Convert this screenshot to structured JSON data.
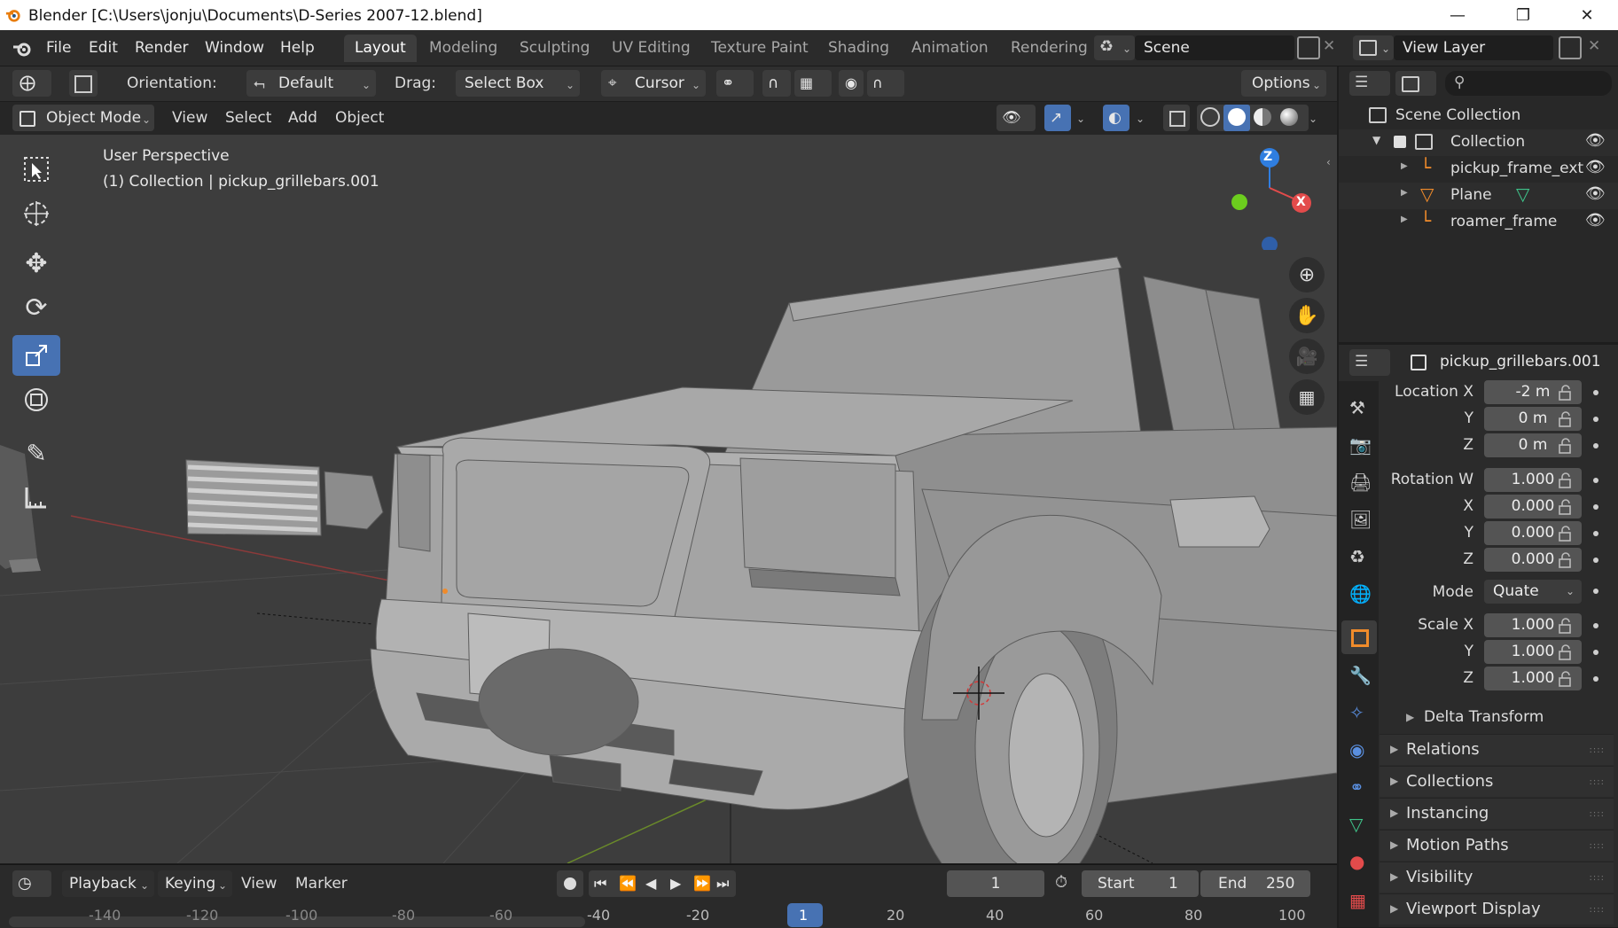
{
  "window": {
    "title": "Blender [C:\\Users\\jonju\\Documents\\D-Series 2007-12.blend]"
  },
  "menu": [
    "File",
    "Edit",
    "Render",
    "Window",
    "Help"
  ],
  "workspaces": [
    "Layout",
    "Modeling",
    "Sculpting",
    "UV Editing",
    "Texture Paint",
    "Shading",
    "Animation",
    "Rendering"
  ],
  "scene": {
    "name": "Scene",
    "view_layer": "View Layer"
  },
  "tool_header": {
    "orientation_label": "Orientation:",
    "orientation_value": "Default",
    "drag_label": "Drag:",
    "drag_value": "Select Box",
    "pivot_value": "Cursor",
    "options": "Options"
  },
  "viewport_header": {
    "mode": "Object Mode",
    "menus": [
      "View",
      "Select",
      "Add",
      "Object"
    ]
  },
  "viewport": {
    "perspective": "User Perspective",
    "collection_info": "(1) Collection | pickup_grillebars.001",
    "gizmo": {
      "x": "X",
      "z": "Z"
    }
  },
  "outliner": {
    "root": "Scene Collection",
    "collection": "Collection",
    "items": [
      {
        "name": "pickup_frame_ext",
        "type": "armature"
      },
      {
        "name": "Plane",
        "type": "mesh"
      },
      {
        "name": "roamer_frame",
        "type": "armature"
      }
    ]
  },
  "properties": {
    "object_name": "pickup_grillebars.001",
    "location": {
      "label": "Location X",
      "x": "-2 m",
      "y": "0 m",
      "z": "0 m"
    },
    "rotation": {
      "label": "Rotation W",
      "w": "1.000",
      "x": "0.000",
      "y": "0.000",
      "z": "0.000"
    },
    "mode_label": "Mode",
    "mode_value": "Quate",
    "scale": {
      "label": "Scale X",
      "x": "1.000",
      "y": "1.000",
      "z": "1.000"
    },
    "axis_y": "Y",
    "axis_z": "Z",
    "axis_x": "X",
    "delta": "Delta Transform",
    "panels": [
      "Relations",
      "Collections",
      "Instancing",
      "Motion Paths",
      "Visibility",
      "Viewport Display"
    ]
  },
  "timeline": {
    "menus": [
      "Playback",
      "Keying",
      "View",
      "Marker"
    ],
    "current_frame": "1",
    "start_label": "Start",
    "start": "1",
    "end_label": "End",
    "end": "250",
    "ruler": [
      "-140",
      "-120",
      "-100",
      "-80",
      "-60",
      "-40",
      "-20",
      "1",
      "20",
      "40",
      "60",
      "80",
      "100"
    ]
  },
  "colors": {
    "accent": "#4772b3",
    "gizmo_x": "#e34b4b",
    "gizmo_y": "#6ccd1e",
    "gizmo_z": "#2f7ee0",
    "object_orange": "#f08b2b"
  }
}
